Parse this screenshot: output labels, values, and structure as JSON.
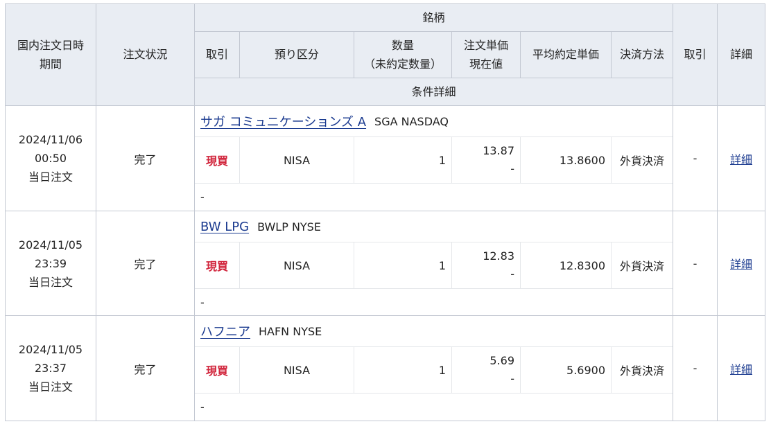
{
  "header": {
    "datetime": [
      "国内注文日時",
      "期間"
    ],
    "status": "注文状況",
    "brand": "銘柄",
    "trade": "取引",
    "account_type": "預り区分",
    "quantity": [
      "数量",
      "（未約定数量）"
    ],
    "unit_price": [
      "注文単価",
      "現在値"
    ],
    "avg_price": "平均約定単価",
    "settlement": "決済方法",
    "trade2": "取引",
    "detail": "詳細",
    "condition": "条件詳細"
  },
  "orders": [
    {
      "date": "2024/11/06",
      "time": "00:50",
      "period": "当日注文",
      "status": "完了",
      "name": "サガ コミュニケーションズ A",
      "ticker": "SGA NASDAQ",
      "trade": "現買",
      "account": "NISA",
      "quantity": "1",
      "unit_price": "13.87",
      "current": "-",
      "avg_price": "13.8600",
      "settlement": "外貨決済",
      "trade2": "-",
      "detail": "詳細",
      "condition": "-"
    },
    {
      "date": "2024/11/05",
      "time": "23:39",
      "period": "当日注文",
      "status": "完了",
      "name": "BW LPG",
      "ticker": "BWLP NYSE",
      "trade": "現買",
      "account": "NISA",
      "quantity": "1",
      "unit_price": "12.83",
      "current": "-",
      "avg_price": "12.8300",
      "settlement": "外貨決済",
      "trade2": "-",
      "detail": "詳細",
      "condition": "-"
    },
    {
      "date": "2024/11/05",
      "time": "23:37",
      "period": "当日注文",
      "status": "完了",
      "name": "ハフニア",
      "ticker": "HAFN NYSE",
      "trade": "現買",
      "account": "NISA",
      "quantity": "1",
      "unit_price": "5.69",
      "current": "-",
      "avg_price": "5.6900",
      "settlement": "外貨決済",
      "trade2": "-",
      "detail": "詳細",
      "condition": "-"
    }
  ],
  "colors": {
    "header_bg": "#e9edf3",
    "border": "#c3c8d2",
    "link": "#1a3a8f",
    "buy": "#d1243b"
  }
}
